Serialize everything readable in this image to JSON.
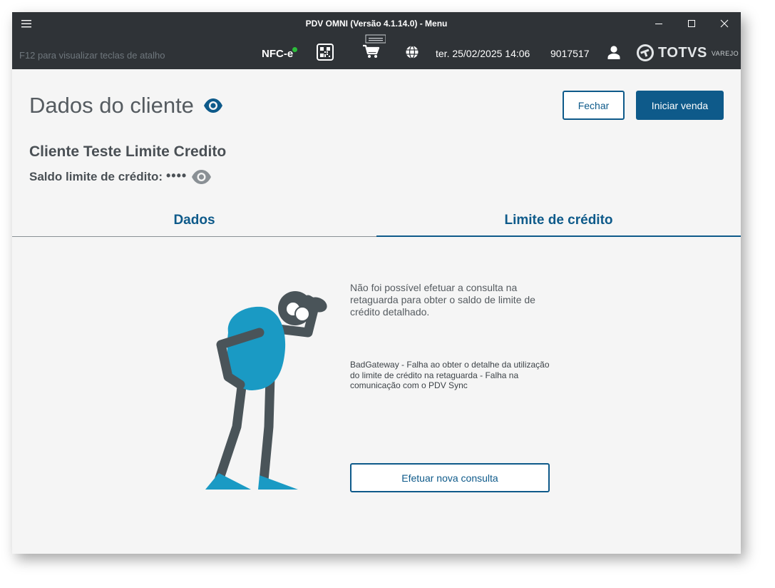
{
  "window": {
    "title": "PDV OMNI (Versão 4.1.14.0) - Menu"
  },
  "header": {
    "shortcut_hint": "F12 para visualizar teclas de atalho",
    "nfce_label": "NFC-e",
    "datetime": "ter. 25/02/2025 14:06",
    "operator_code": "9017517",
    "brand": {
      "name": "TOTVS",
      "suffix": "VAREJO"
    },
    "icons": [
      "menu-icon",
      "qrcode-icon",
      "cart-icon",
      "globe-icon",
      "user-icon",
      "totvs-logo-icon"
    ]
  },
  "page": {
    "title": "Dados do cliente",
    "close_label": "Fechar",
    "start_sale_label": "Iniciar venda"
  },
  "client": {
    "name": "Cliente Teste Limite Credito",
    "credit_label": "Saldo limite de crédito:",
    "credit_value_masked": "••••"
  },
  "tabs": [
    {
      "label": "Dados",
      "active": false
    },
    {
      "label": "Limite de crédito",
      "active": true
    }
  ],
  "error_panel": {
    "message": "Não foi possível efetuar a consulta na retaguarda para obter o saldo de limite de crédito detalhado.",
    "detail": "BadGateway - Falha ao obter o detalhe da utilização do limite de crédito na retaguarda - Falha na comunicação com o PDV Sync",
    "retry_label": "Efetuar nova consulta"
  },
  "colors": {
    "primary": "#0e5a8a",
    "titlebar": "#2f3337",
    "background": "#f5f5f5",
    "figure_gray": "#4a5459",
    "figure_blue": "#1a9ac4",
    "status_green": "#2bbd3a"
  }
}
